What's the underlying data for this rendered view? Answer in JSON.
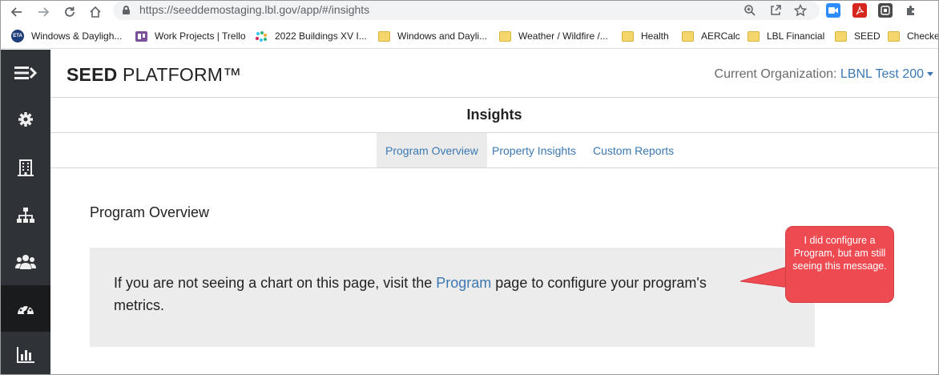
{
  "browser": {
    "url": "https://seeddemostaging.lbl.gov/app/#/insights",
    "icons": [
      "back-icon",
      "forward-icon",
      "reload-icon",
      "home-icon",
      "lock-icon",
      "zoom-icon",
      "share-icon",
      "star-icon",
      "zoom-app-icon",
      "acrobat-icon",
      "extension-icon",
      "puzzle-icon"
    ]
  },
  "bookmarks": [
    {
      "label": "Windows & Dayligh...",
      "icon": "eta-icon"
    },
    {
      "label": "Work Projects | Trello",
      "icon": "trello-icon"
    },
    {
      "label": "2022 Buildings XV I...",
      "icon": "slack-icon"
    },
    {
      "label": "Windows and Dayli...",
      "icon": "folder-icon"
    },
    {
      "label": "Weather / Wildfire /...",
      "icon": "folder-icon"
    },
    {
      "label": "Health",
      "icon": "folder-icon"
    },
    {
      "label": "AERCalc",
      "icon": "folder-icon"
    },
    {
      "label": "LBL Financial",
      "icon": "folder-icon"
    },
    {
      "label": "SEED",
      "icon": "folder-icon"
    },
    {
      "label": "Checke",
      "icon": "folder-icon"
    }
  ],
  "sidebar": {
    "items": [
      {
        "icon": "menu-toggle-icon"
      },
      {
        "icon": "gear-icon"
      },
      {
        "icon": "building-icon"
      },
      {
        "icon": "hierarchy-icon"
      },
      {
        "icon": "users-icon"
      },
      {
        "icon": "dashboard-gauge-icon",
        "active": true
      },
      {
        "icon": "bar-chart-icon"
      }
    ]
  },
  "header": {
    "brand_bold": "SEED",
    "brand_rest": " PLATFORM™",
    "org_label": "Current Organization: ",
    "org_name": "LBNL Test 200"
  },
  "page": {
    "title": "Insights",
    "tabs": [
      {
        "label": "Program Overview",
        "active": true
      },
      {
        "label": "Property Insights",
        "active": false
      },
      {
        "label": "Custom Reports",
        "active": false
      }
    ],
    "section_title": "Program Overview",
    "message_before": "If you are not seeing a chart on this page, visit the ",
    "message_link": "Program",
    "message_after": " page to configure your program's metrics."
  },
  "annotation": {
    "text": "I did configure a Program, but am still seeing this message."
  },
  "colors": {
    "sidebar_bg": "#2f3236",
    "sidebar_active": "#191b1d",
    "link": "#3b78b3",
    "callout": "#ee4a52",
    "infobox_bg": "#ececec"
  }
}
